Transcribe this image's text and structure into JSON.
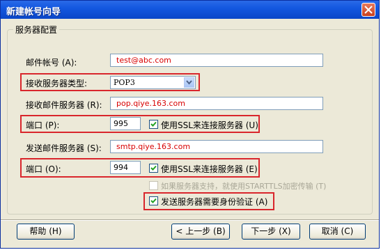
{
  "window": {
    "title": "新建帐号向导"
  },
  "group": {
    "label": "服务器配置"
  },
  "account": {
    "label": "邮件帐号 (A):",
    "value": "test@abc.com"
  },
  "server_type": {
    "label": "接收服务器类型:",
    "value": "POP3"
  },
  "incoming": {
    "label": "接收邮件服务器 (R):",
    "value": "pop.qiye.163.com"
  },
  "in_port": {
    "label": "端口 (P):",
    "value": "995",
    "ssl_label": "使用SSL来连接服务器 (U)",
    "ssl_checked": true
  },
  "outgoing": {
    "label": "发送邮件服务器 (S):",
    "value": "smtp.qiye.163.com"
  },
  "out_port": {
    "label": "端口 (O):",
    "value": "994",
    "ssl_label": "使用SSL来连接服务器 (E)",
    "ssl_checked": true
  },
  "starttls": {
    "label": "如果服务器支持，就使用STARTTLS加密传输 (T)",
    "checked": false,
    "disabled": true
  },
  "auth": {
    "label": "发送服务器需要身份验证 (A)",
    "checked": true
  },
  "buttons": {
    "help": "帮助 (H)",
    "back": "< 上一步 (B)",
    "next": "下一步 (X)",
    "cancel": "取消 (C)"
  },
  "colors": {
    "highlight": "#d9262c",
    "titlebar": "#1458e0",
    "field_text": "#d80000"
  }
}
